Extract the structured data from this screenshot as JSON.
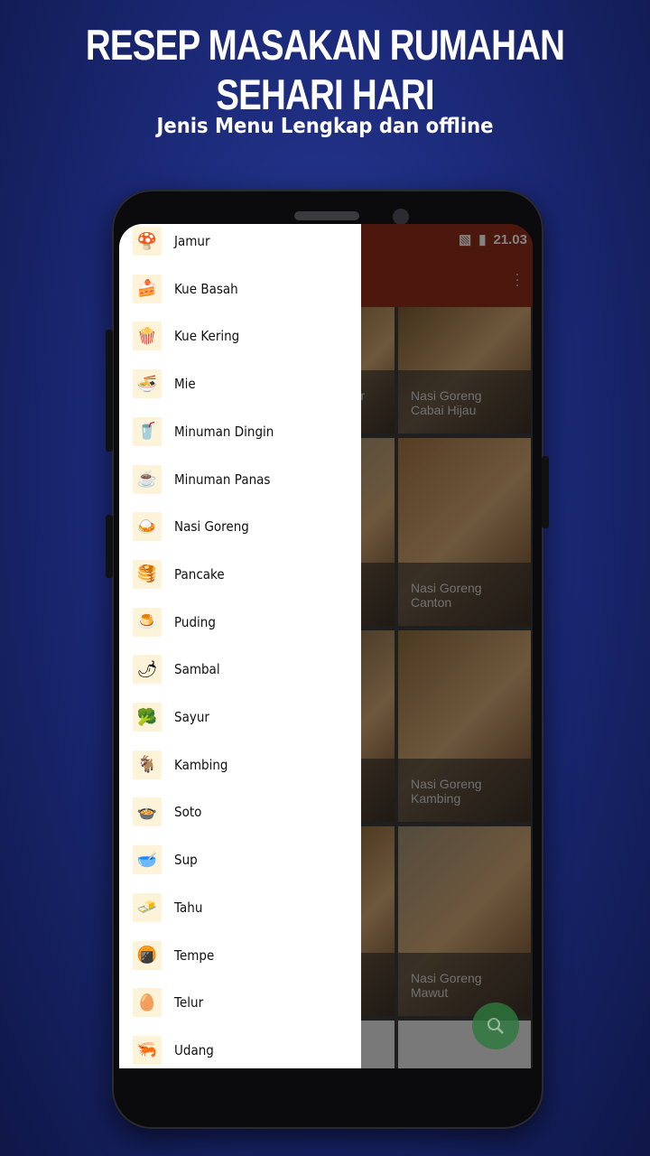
{
  "promo": {
    "headline": "RESEP MASAKAN RUMAHAN SEHARI HARI",
    "subtitle": "Jenis Menu Lengkap dan offline"
  },
  "status_bar": {
    "time": "21.03",
    "icons": [
      "no-sim-icon",
      "battery-charging-icon"
    ]
  },
  "app_bar": {
    "menu_icon": "more-vert-icon",
    "color": "#8a2a16"
  },
  "cards": [
    {
      "title": "adar",
      "col": "left"
    },
    {
      "title": "Nasi Goreng Cabai Hijau",
      "col": "right"
    },
    {
      "title": "",
      "col": "left"
    },
    {
      "title": "Nasi Goreng Canton",
      "col": "right"
    },
    {
      "title": "",
      "col": "left"
    },
    {
      "title": "Nasi Goreng Kambing",
      "col": "right"
    },
    {
      "title": "d",
      "col": "left"
    },
    {
      "title": "Nasi Goreng Mawut",
      "col": "right"
    }
  ],
  "fab": {
    "icon": "search-icon",
    "color": "#2e7a3e"
  },
  "drawer": {
    "items": [
      {
        "label": "Jamur",
        "icon": "🍄"
      },
      {
        "label": "Kue Basah",
        "icon": "🍰"
      },
      {
        "label": "Kue Kering",
        "icon": "🍿"
      },
      {
        "label": "Mie",
        "icon": "🍜"
      },
      {
        "label": "Minuman Dingin",
        "icon": "🥤"
      },
      {
        "label": "Minuman Panas",
        "icon": "☕"
      },
      {
        "label": "Nasi Goreng",
        "icon": "🍛"
      },
      {
        "label": "Pancake",
        "icon": "🥞"
      },
      {
        "label": "Puding",
        "icon": "🍮"
      },
      {
        "label": "Sambal",
        "icon": "🌶"
      },
      {
        "label": "Sayur",
        "icon": "🥦"
      },
      {
        "label": "Kambing",
        "icon": "🐐"
      },
      {
        "label": "Soto",
        "icon": "🍲"
      },
      {
        "label": "Sup",
        "icon": "🥣"
      },
      {
        "label": "Tahu",
        "icon": "🧈"
      },
      {
        "label": "Tempe",
        "icon": "🍘"
      },
      {
        "label": "Telur",
        "icon": "🥚"
      },
      {
        "label": "Udang",
        "icon": "🦐"
      }
    ]
  }
}
